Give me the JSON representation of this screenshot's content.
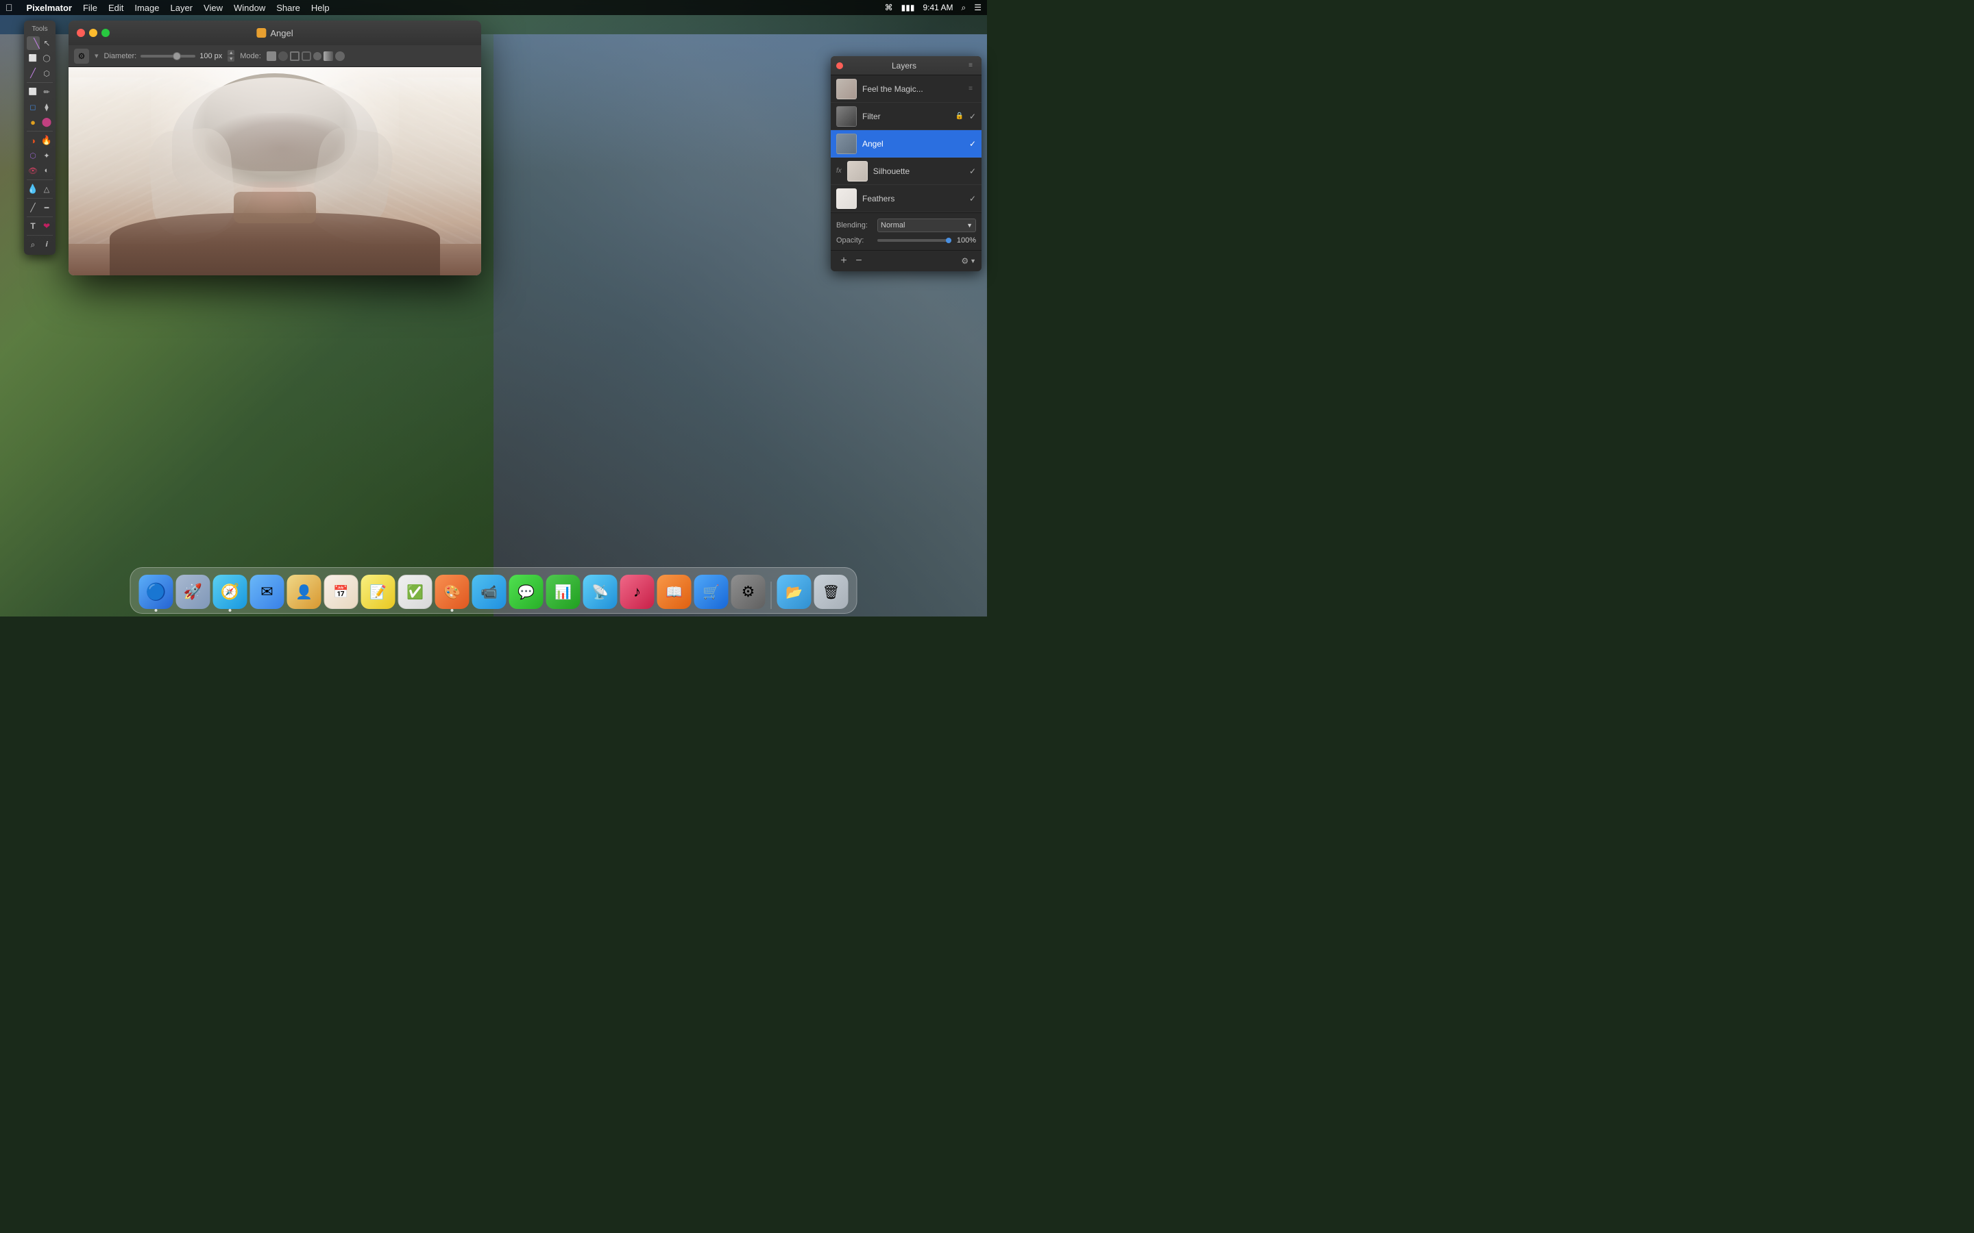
{
  "menubar": {
    "apple": "",
    "app_name": "Pixelmator",
    "items": [
      "File",
      "Edit",
      "Image",
      "Layer",
      "View",
      "Window",
      "Share",
      "Help"
    ],
    "right": {
      "wifi": "wifi",
      "battery": "battery",
      "time": "9:41 AM",
      "search": "search",
      "menu": "menu"
    }
  },
  "window": {
    "title": "Angel",
    "title_icon": "orange-square",
    "controls": {
      "close": "close",
      "minimize": "minimize",
      "maximize": "maximize"
    }
  },
  "toolbar": {
    "gear_label": "⚙",
    "diameter_label": "Diameter:",
    "diameter_value": "100 px",
    "mode_label": "Mode:"
  },
  "tools_panel": {
    "title": "Tools",
    "tools": [
      {
        "name": "paint-brush",
        "icon": "🖌",
        "active": true
      },
      {
        "name": "selection",
        "icon": "↖"
      },
      {
        "name": "rect-select",
        "icon": "▭"
      },
      {
        "name": "ellipse-select",
        "icon": "◯"
      },
      {
        "name": "paint-brush2",
        "icon": "/"
      },
      {
        "name": "crop",
        "icon": "⊡"
      },
      {
        "name": "pencil",
        "icon": "✏"
      },
      {
        "name": "eraser",
        "icon": "◻"
      },
      {
        "name": "stamp",
        "icon": "⬡"
      },
      {
        "name": "paint-bucket",
        "icon": "⬛"
      },
      {
        "name": "dodge",
        "icon": "☀"
      },
      {
        "name": "fill",
        "icon": "◑"
      },
      {
        "name": "smudge",
        "icon": "🖐"
      },
      {
        "name": "blend",
        "icon": "◐"
      },
      {
        "name": "transform",
        "icon": "⬜"
      },
      {
        "name": "eye",
        "icon": "👁"
      },
      {
        "name": "heal",
        "icon": "✦"
      },
      {
        "name": "blur",
        "icon": "💧"
      },
      {
        "name": "sharpen",
        "icon": "△"
      },
      {
        "name": "line",
        "icon": "╱"
      },
      {
        "name": "gradient",
        "icon": "━"
      },
      {
        "name": "text",
        "icon": "T"
      },
      {
        "name": "heart",
        "icon": "❤"
      },
      {
        "name": "zoom",
        "icon": "⌕"
      },
      {
        "name": "eyedropper",
        "icon": "𝒊"
      }
    ]
  },
  "layers": {
    "panel_title": "Layers",
    "close_btn": "close",
    "menu_btn": "≡",
    "items": [
      {
        "name": "feel-the-magic",
        "label": "Feel the Magic...",
        "thumb_type": "feel",
        "checked": false,
        "has_lock": false,
        "has_fx": false
      },
      {
        "name": "filter",
        "label": "Filter",
        "thumb_type": "filter",
        "checked": true,
        "has_lock": true,
        "has_fx": false
      },
      {
        "name": "angel",
        "label": "Angel",
        "thumb_type": "angel",
        "checked": true,
        "has_lock": false,
        "has_fx": false,
        "active": true
      },
      {
        "name": "silhouette",
        "label": "Silhouette",
        "thumb_type": "silhouette",
        "checked": true,
        "has_lock": false,
        "has_fx": true
      },
      {
        "name": "feathers",
        "label": "Feathers",
        "thumb_type": "feathers",
        "checked": true,
        "has_lock": false,
        "has_fx": false
      }
    ],
    "blending_label": "Blending:",
    "blending_value": "Normal",
    "opacity_label": "Opacity:",
    "opacity_value": "100%",
    "footer": {
      "add_label": "+",
      "remove_label": "−",
      "settings_label": "⚙"
    }
  },
  "dock": {
    "items": [
      {
        "name": "finder",
        "icon": "🔍",
        "label": "Finder",
        "has_dot": true,
        "color": "#5baef8"
      },
      {
        "name": "launchpad",
        "icon": "🚀",
        "label": "Launchpad",
        "color": "#a8b8d0"
      },
      {
        "name": "safari",
        "icon": "🧭",
        "label": "Safari",
        "has_dot": true,
        "color": "#4ec8f8"
      },
      {
        "name": "mail",
        "icon": "✉",
        "label": "Mail",
        "color": "#6ab0f8"
      },
      {
        "name": "contacts",
        "icon": "👤",
        "label": "Contacts",
        "color": "#f8d880"
      },
      {
        "name": "calendar",
        "icon": "📅",
        "label": "Calendar",
        "color": "#f8f0e8"
      },
      {
        "name": "notes",
        "icon": "📝",
        "label": "Notes",
        "color": "#f8f080"
      },
      {
        "name": "reminders",
        "icon": "✓",
        "label": "Reminders",
        "color": "#e8e8e8"
      },
      {
        "name": "pixelmator",
        "icon": "✏",
        "label": "Pixelmator",
        "has_dot": true,
        "color": "#f89050"
      },
      {
        "name": "facetime",
        "icon": "📹",
        "label": "FaceTime",
        "color": "#58c8f8"
      },
      {
        "name": "messages",
        "icon": "💬",
        "label": "Messages",
        "color": "#60e860"
      },
      {
        "name": "numbers",
        "icon": "📊",
        "label": "Numbers",
        "color": "#60c860"
      },
      {
        "name": "airdrop",
        "icon": "📡",
        "label": "AirDrop",
        "color": "#60d8f8"
      },
      {
        "name": "music",
        "icon": "♪",
        "label": "Music",
        "color": "#f06888"
      },
      {
        "name": "books",
        "icon": "📖",
        "label": "Books",
        "color": "#f89848"
      },
      {
        "name": "appstore",
        "icon": "🛒",
        "label": "App Store",
        "color": "#50a8f8"
      },
      {
        "name": "syspref",
        "icon": "⚙",
        "label": "System Preferences",
        "color": "#888"
      },
      {
        "name": "airdrop2",
        "icon": "📂",
        "label": "AirDrop",
        "color": "#60d8f8"
      },
      {
        "name": "trash",
        "icon": "🗑",
        "label": "Trash",
        "color": "#c8d0d8"
      }
    ]
  }
}
